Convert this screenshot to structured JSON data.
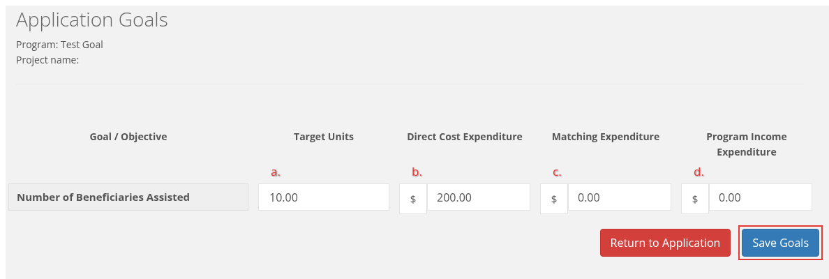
{
  "page": {
    "title": "Application Goals",
    "program": "Program: Test Goal",
    "project": "Project name:"
  },
  "table": {
    "goal_header": "Goal / Objective",
    "columns": [
      {
        "header": "Target Units",
        "marker": "a.",
        "kind": "number",
        "value": "10.00"
      },
      {
        "header": "Direct Cost Expenditure",
        "marker": "b.",
        "kind": "currency",
        "prefix": "$",
        "value": "200.00"
      },
      {
        "header": "Matching Expenditure",
        "marker": "c.",
        "kind": "currency",
        "prefix": "$",
        "value": "0.00"
      },
      {
        "header": "Program Income Expenditure",
        "marker": "d.",
        "kind": "currency",
        "prefix": "$",
        "value": "0.00"
      }
    ],
    "goal": "Number of Beneficiaries Assisted"
  },
  "buttons": [
    {
      "label": "Return to Application",
      "kind": "danger",
      "highlighted": false
    },
    {
      "label": "Save Goals",
      "kind": "primary",
      "highlighted": true
    }
  ]
}
